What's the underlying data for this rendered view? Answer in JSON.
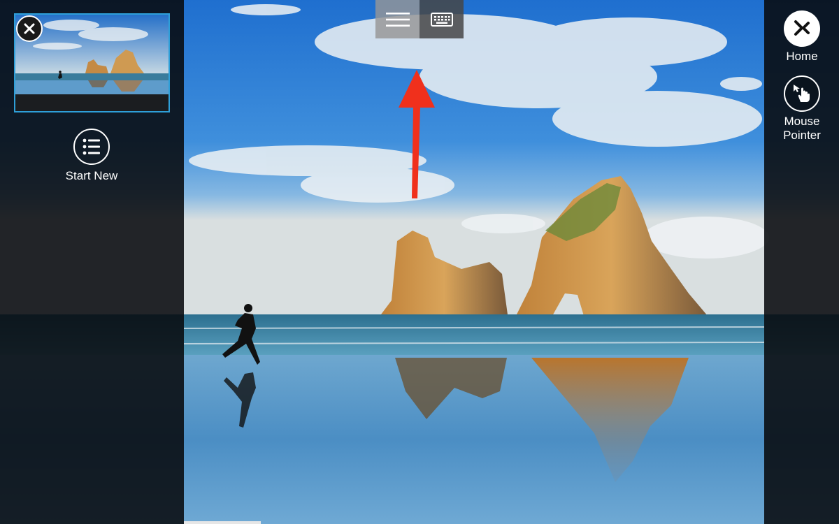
{
  "left_panel": {
    "start_new_label": "Start New"
  },
  "right_panel": {
    "home_label": "Home",
    "mouse_pointer_label": "Mouse\nPointer"
  },
  "icons": {
    "close": "close-icon",
    "start_new": "list-icon",
    "home": "remote-desktop-icon",
    "pointer": "hand-pointer-icon",
    "menu": "hamburger-menu-icon",
    "keyboard": "keyboard-icon",
    "hint": "up-arrow-icon"
  },
  "colors": {
    "thumbnail_border": "#2e9fd8",
    "hint_arrow": "#f0301c"
  }
}
